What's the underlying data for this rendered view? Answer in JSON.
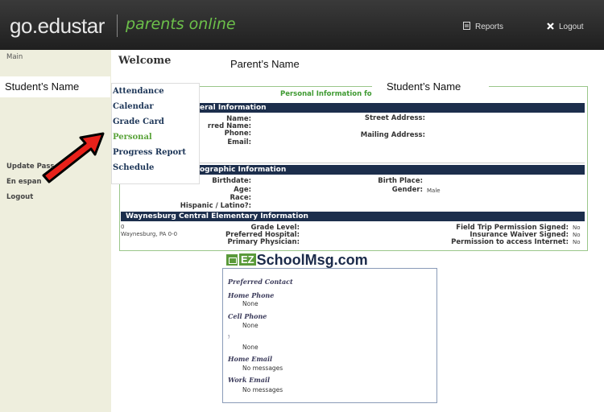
{
  "header": {
    "brand": "go.edustar",
    "tagline": "parents online",
    "reports_label": "Reports",
    "logout_label": "Logout"
  },
  "sidebar": {
    "main_label": "Main",
    "links": [
      "Update Pass",
      "En espan",
      "Logout"
    ]
  },
  "annotations": {
    "student_left": "Student’s Name",
    "parent": "Parent’s Name",
    "student_right": "Student’s Name"
  },
  "page": {
    "welcome": "Welcome"
  },
  "menu": {
    "items": [
      "Attendance",
      "Calendar",
      "Grade Card",
      "Personal",
      "Progress Report",
      "Schedule"
    ],
    "active": "Personal"
  },
  "personal": {
    "title": "Personal Information for",
    "general": {
      "title": "eral Information",
      "labels": [
        "Name:",
        "rred Name:",
        "Phone:",
        "Email:"
      ],
      "street_label": "Street Address:",
      "mailing_label": "Mailing Address:"
    },
    "demographic": {
      "title": "ographic Information",
      "labels": [
        "Birthdate:",
        "Age:",
        "Race:",
        "Hispanic / Latino?:"
      ],
      "birth_place_label": "Birth Place:",
      "gender_label": "Gender:",
      "gender_value": "Male"
    },
    "school": {
      "title": "Waynesburg Central Elementary Information",
      "addr_line1": "0",
      "addr_line2": "Waynesburg, PA 0-0",
      "labels": [
        "Grade Level:",
        "Preferred Hospital:",
        "Primary Physician:"
      ],
      "right_labels": [
        "Field Trip Permission Signed:",
        "Insurance Waiver Signed:",
        "Permission to access Internet:"
      ],
      "right_values": [
        "No",
        "No",
        "No"
      ]
    }
  },
  "ezschool": {
    "logo_ez": "EZ",
    "logo_rest": "SchoolMsg.com",
    "heading": "Preferred Contact",
    "rows": [
      {
        "label": "Home Phone",
        "value": "None"
      },
      {
        "label": "Cell Phone",
        "value": "None"
      },
      {
        "label": "ו",
        "value": "None"
      },
      {
        "label": "Home Email",
        "value": "No messages"
      },
      {
        "label": "Work Email",
        "value": "No messages"
      }
    ]
  },
  "colors": {
    "topbar": "#2b2b2b",
    "tagline": "#6cc04a",
    "section_bar": "#1c2e4c",
    "sidebar_bg": "#eeeedd",
    "active_menu": "#5aa33a",
    "arrow": "#e8211a"
  }
}
